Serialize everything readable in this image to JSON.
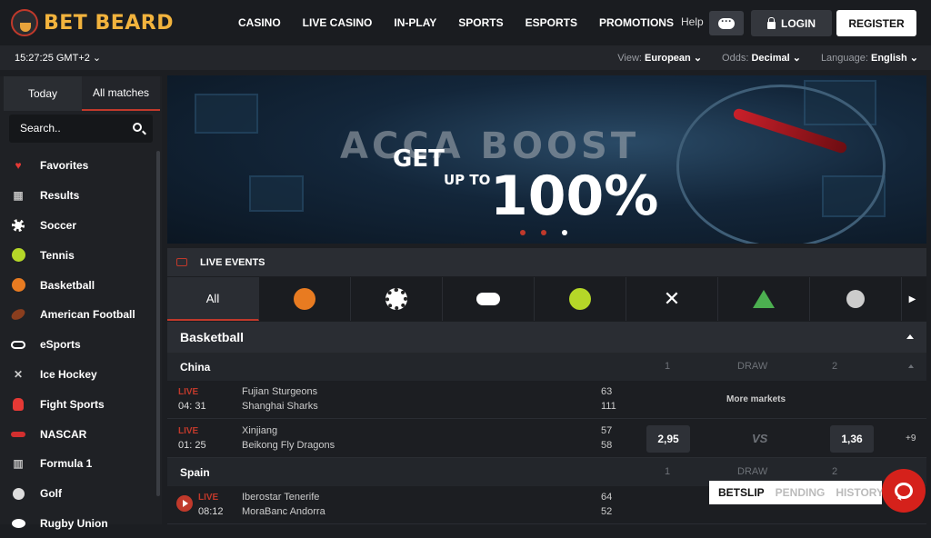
{
  "brand": {
    "name": "BET BEARD",
    "accent": "#c0392b"
  },
  "nav": {
    "items": [
      "CASINO",
      "LIVE CASINO",
      "IN-PLAY",
      "SPORTS",
      "ESPORTS",
      "PROMOTIONS"
    ]
  },
  "header": {
    "help": "Help",
    "login": "LOGIN",
    "register": "REGISTER"
  },
  "subbar": {
    "clock": "15:27:25 GMT+2 ⌄",
    "view_label": "View:",
    "view_value": "European ⌄",
    "odds_label": "Odds:",
    "odds_value": "Decimal ⌄",
    "lang_label": "Language:",
    "lang_value": "English ⌄"
  },
  "sidebar": {
    "tabs": [
      "Today",
      "All matches"
    ],
    "search_placeholder": "Search..",
    "sports": [
      "Favorites",
      "Results",
      "Soccer",
      "Tennis",
      "Basketball",
      "American Football",
      "eSports",
      "Ice Hockey",
      "Fight Sports",
      "NASCAR",
      "Formula 1",
      "Golf",
      "Rugby Union"
    ]
  },
  "banner": {
    "headline": "ACCA BOOST",
    "get": "GET",
    "upto": "UP TO",
    "percent": "100%"
  },
  "live": {
    "title": "LIVE EVENTS",
    "all_tab": "All",
    "section": "Basketball",
    "col1": "1",
    "col_draw": "DRAW",
    "col2": "2",
    "leagues": [
      {
        "name": "China"
      },
      {
        "name": "Spain"
      }
    ],
    "matches": [
      {
        "live": "LIVE",
        "time": "04: 31",
        "team1": "Fujian Sturgeons",
        "team2": "Shanghai Sharks",
        "score1": "63",
        "score2": "111",
        "more": "More markets"
      },
      {
        "live": "LIVE",
        "time": "01: 25",
        "team1": "Xinjiang",
        "team2": "Beikong Fly Dragons",
        "score1": "57",
        "score2": "58",
        "odd1": "2,95",
        "vs": "VS",
        "odd2": "1,36",
        "plus": "+9"
      },
      {
        "live": "LIVE",
        "time": "08:12",
        "team1": "Iberostar Tenerife",
        "team2": "MoraBanc Andorra",
        "score1": "64",
        "score2": "52"
      }
    ]
  },
  "betslip": {
    "tabs": [
      "BETSLIP",
      "PENDING",
      "HISTORY"
    ]
  }
}
